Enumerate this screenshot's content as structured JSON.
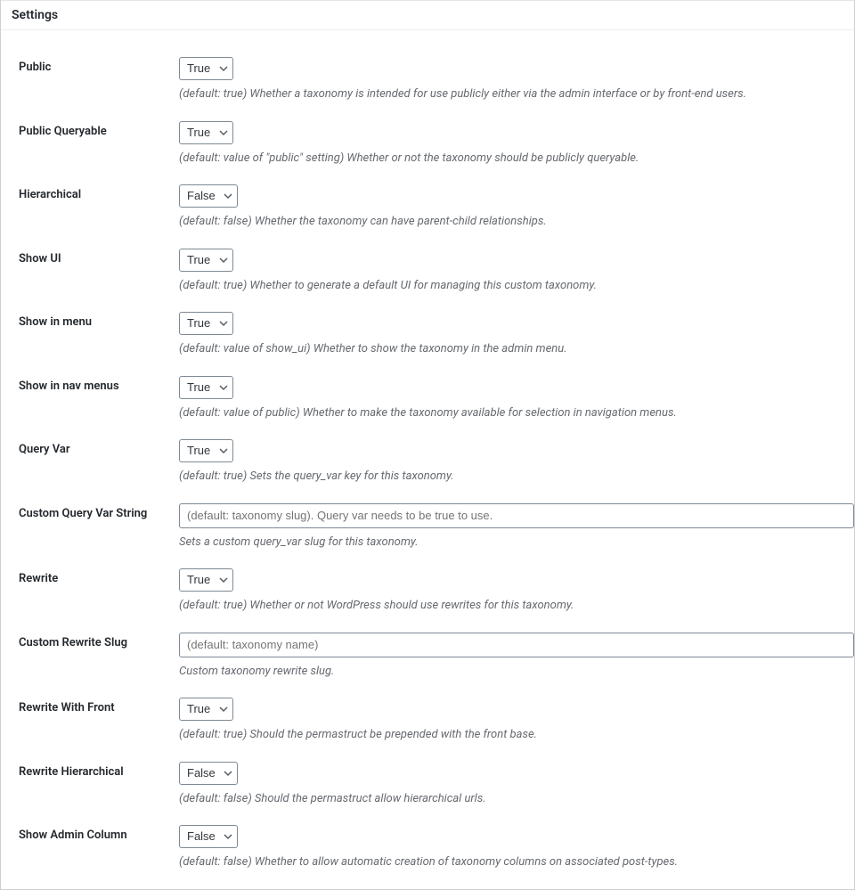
{
  "panel": {
    "title": "Settings"
  },
  "options": {
    "true": "True",
    "false": "False"
  },
  "rows": {
    "public": {
      "label": "Public",
      "value": "True",
      "desc": "(default: true) Whether a taxonomy is intended for use publicly either via the admin interface or by front-end users."
    },
    "public_queryable": {
      "label": "Public Queryable",
      "value": "True",
      "desc": "(default: value of \"public\" setting) Whether or not the taxonomy should be publicly queryable."
    },
    "hierarchical": {
      "label": "Hierarchical",
      "value": "False",
      "desc": "(default: false) Whether the taxonomy can have parent-child relationships."
    },
    "show_ui": {
      "label": "Show UI",
      "value": "True",
      "desc": "(default: true) Whether to generate a default UI for managing this custom taxonomy."
    },
    "show_in_menu": {
      "label": "Show in menu",
      "value": "True",
      "desc": "(default: value of show_ui) Whether to show the taxonomy in the admin menu."
    },
    "show_in_nav_menus": {
      "label": "Show in nav menus",
      "value": "True",
      "desc": "(default: value of public) Whether to make the taxonomy available for selection in navigation menus."
    },
    "query_var": {
      "label": "Query Var",
      "value": "True",
      "desc": "(default: true) Sets the query_var key for this taxonomy."
    },
    "custom_query_var": {
      "label": "Custom Query Var String",
      "placeholder": "(default: taxonomy slug). Query var needs to be true to use.",
      "desc": "Sets a custom query_var slug for this taxonomy."
    },
    "rewrite": {
      "label": "Rewrite",
      "value": "True",
      "desc": "(default: true) Whether or not WordPress should use rewrites for this taxonomy."
    },
    "custom_rewrite_slug": {
      "label": "Custom Rewrite Slug",
      "placeholder": "(default: taxonomy name)",
      "desc": "Custom taxonomy rewrite slug."
    },
    "rewrite_with_front": {
      "label": "Rewrite With Front",
      "value": "True",
      "desc": "(default: true) Should the permastruct be prepended with the front base."
    },
    "rewrite_hierarchical": {
      "label": "Rewrite Hierarchical",
      "value": "False",
      "desc": "(default: false) Should the permastruct allow hierarchical urls."
    },
    "show_admin_column": {
      "label": "Show Admin Column",
      "value": "False",
      "desc": "(default: false) Whether to allow automatic creation of taxonomy columns on associated post-types."
    }
  }
}
